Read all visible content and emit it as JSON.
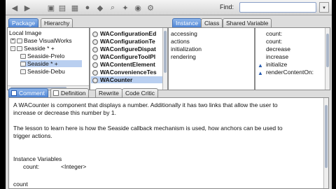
{
  "toolbar": {
    "find_label": "Find:",
    "find_value": "",
    "dropdown_glyph": "▾"
  },
  "left_tabs": [
    "Package",
    "Hierarchy"
  ],
  "package_tree": {
    "header": "Local Image",
    "items": [
      {
        "label": "Base VisualWorks",
        "toggle": "+"
      },
      {
        "label": "Seaside * +",
        "toggle": "-"
      },
      {
        "label": "Seaside-Prelo",
        "toggle": ""
      },
      {
        "label": "Seaside * +",
        "toggle": ""
      },
      {
        "label": "Seaside-Debu",
        "toggle": ""
      }
    ]
  },
  "class_list": [
    "WAConfigurationEd",
    "WAConfigurationTe",
    "WAConfigureDispat",
    "WAConfigureToolPl",
    "WAContentElement",
    "WAConvenienceTes",
    "WACounter"
  ],
  "instance_tabs": [
    "Instance",
    "Class",
    "Shared Variable"
  ],
  "protocols": [
    "accessing",
    "actions",
    "initialization",
    "rendering"
  ],
  "methods": [
    "count:",
    "count:",
    "decrease",
    "increase",
    "initialize",
    "renderContentOn:"
  ],
  "editor_tabs": [
    "Comment",
    "Definition",
    "Rewrite",
    "Code Critic"
  ],
  "comment": {
    "line1": "A WACounter is component that displays a number. Additionally it has two links that allow the user to",
    "line2": "increase or decrease this number by 1.",
    "line3": "The lesson to learn here is how the Seaside callback mechanism is used, how anchors can be used to",
    "line4": "trigger actions.",
    "line5": "Instance Variables",
    "var_name": "count:",
    "var_type": "<Integer>",
    "line7": "count"
  }
}
